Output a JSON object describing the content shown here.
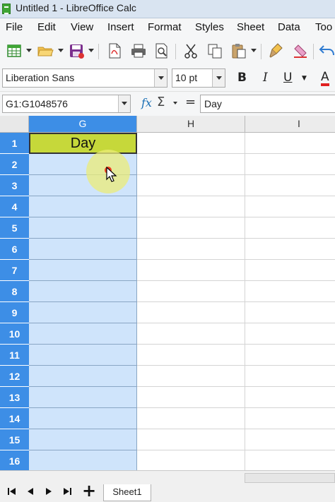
{
  "window": {
    "title": "Untitled 1 - LibreOffice Calc"
  },
  "menu": [
    "File",
    "Edit",
    "View",
    "Insert",
    "Format",
    "Styles",
    "Sheet",
    "Data",
    "Too"
  ],
  "toolbar": {
    "icons": [
      "new-spreadsheet-icon",
      "open-folder-icon",
      "save-icon",
      "export-pdf-icon",
      "print-icon",
      "print-preview-icon",
      "cut-icon",
      "copy-icon",
      "paste-icon",
      "clone-formatting-icon",
      "clear-formatting-icon",
      "undo-icon"
    ]
  },
  "formatting": {
    "font_name": "Liberation Sans",
    "font_size": "10 pt",
    "bold": "B",
    "italic": "I",
    "underline": "U",
    "font_color": "A",
    "font_color_value": "#e02020"
  },
  "formula_bar": {
    "name_box": "G1:G1048576",
    "fx": "fx",
    "sigma": "Σ",
    "equals": "=",
    "content": "Day"
  },
  "grid": {
    "columns": [
      "G",
      "H",
      "I"
    ],
    "selected_column": "G",
    "rows": [
      "1",
      "2",
      "3",
      "4",
      "5",
      "6",
      "7",
      "8",
      "9",
      "10",
      "11",
      "12",
      "13",
      "14",
      "15",
      "16"
    ],
    "cells": {
      "G1": "Day"
    },
    "header_color": "#3d8ee6",
    "selection_color": "#cfe4fb",
    "active_cell_color": "#c6d83a"
  },
  "sheets": {
    "add_label": "+",
    "tabs": [
      "Sheet1"
    ]
  }
}
